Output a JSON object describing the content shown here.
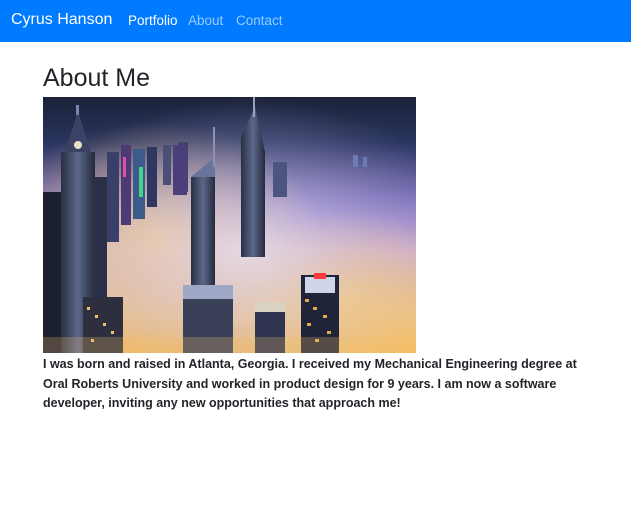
{
  "nav": {
    "brand": "Cyrus Hanson",
    "links": [
      {
        "label": "Portfolio",
        "active": true
      },
      {
        "label": "About",
        "active": false
      },
      {
        "label": "Contact",
        "active": false
      }
    ]
  },
  "main": {
    "heading": "About Me",
    "bio": "I was born and raised in Atlanta, Georgia. I received my Mechanical Engineering degree at Oral Roberts University and worked in product design for 9 years. I am now a software developer, inviting any new opportunities that approach me!"
  },
  "colors": {
    "navbar": "#007bff",
    "text": "#212529"
  }
}
